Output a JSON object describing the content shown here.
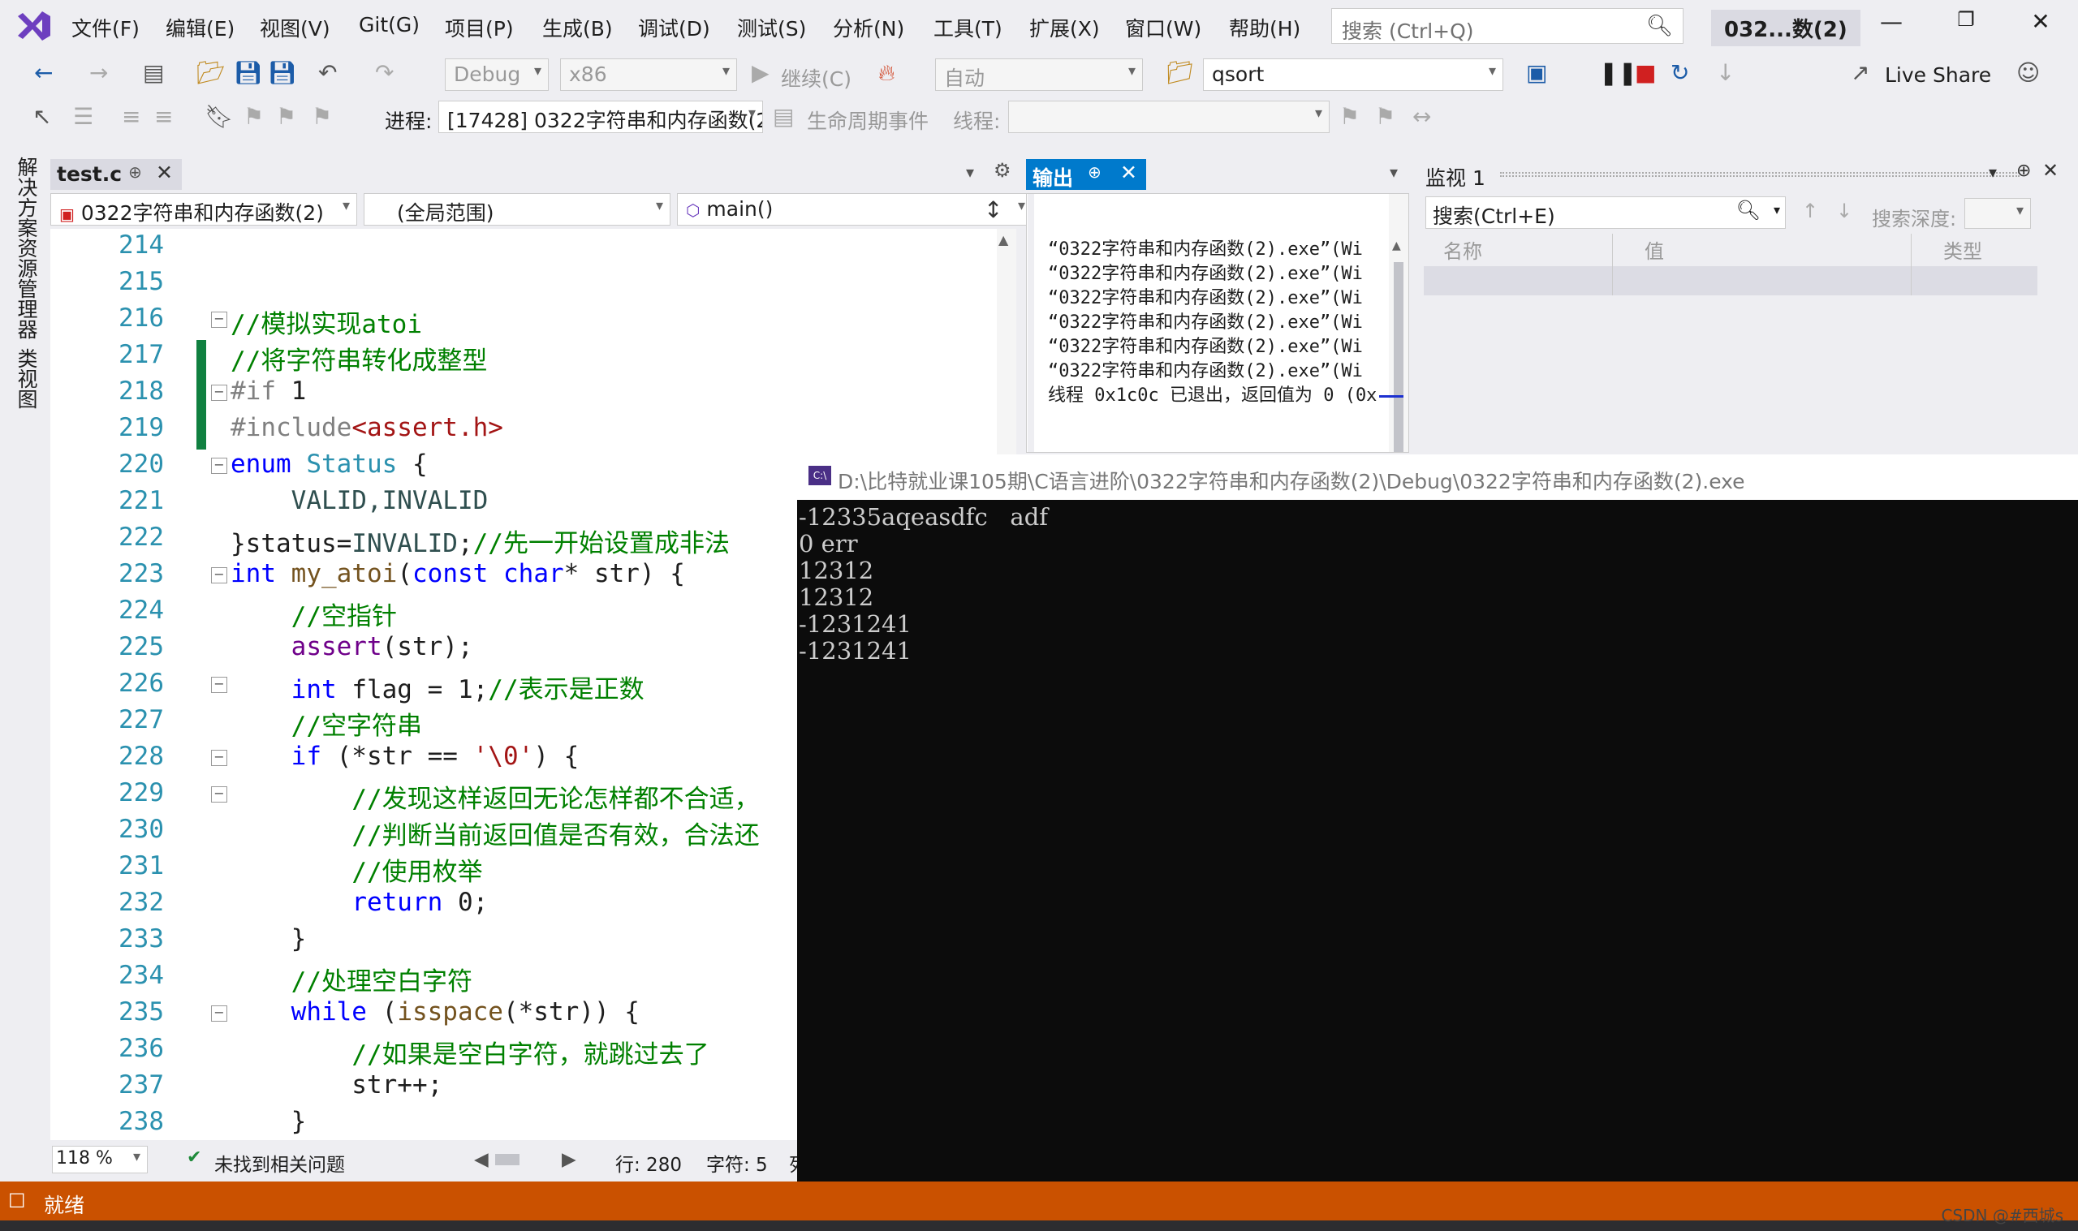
{
  "menu": [
    "文件(F)",
    "编辑(E)",
    "视图(V)",
    "Git(G)",
    "项目(P)",
    "生成(B)",
    "调试(D)",
    "测试(S)",
    "分析(N)",
    "工具(T)",
    "扩展(X)",
    "窗口(W)",
    "帮助(H)"
  ],
  "search": {
    "placeholder": "搜索 (Ctrl+Q)"
  },
  "window_title": "032...数(2)",
  "toolbar1": {
    "config": "Debug",
    "platform": "x86",
    "continue_label": "继续(C)",
    "auto": "自动",
    "find_combo": "qsort",
    "live_share": "Live Share"
  },
  "toolbar2": {
    "process_label": "进程:",
    "process_value": "[17428] 0322字符串和内存函数(2",
    "lifecycle": "生命周期事件",
    "thread_label": "线程:"
  },
  "side_tabs": [
    "解决方案资源管理器",
    "类视图"
  ],
  "editor": {
    "tab": "test.c",
    "nav_project": "0322字符串和内存函数(2)",
    "nav_scope": "(全局范围)",
    "nav_func": "main()",
    "line_numbers": [
      "214",
      "215",
      "216",
      "217",
      "218",
      "219",
      "220",
      "221",
      "222",
      "223",
      "224",
      "225",
      "226",
      "227",
      "228",
      "229",
      "230",
      "231",
      "232",
      "233",
      "234",
      "235",
      "236",
      "237",
      "238"
    ],
    "zoom": "118 %",
    "issues": "未找到相关问题",
    "line": "行: 280",
    "char": "字符: 5",
    "extra": "列"
  },
  "output": {
    "tab": "输出",
    "lines": [
      "“0322字符串和内存函数(2).exe”(Wi",
      "“0322字符串和内存函数(2).exe”(Wi",
      "“0322字符串和内存函数(2).exe”(Wi",
      "“0322字符串和内存函数(2).exe”(Wi",
      "“0322字符串和内存函数(2).exe”(Wi",
      "“0322字符串和内存函数(2).exe”(Wi",
      "线程 0x1c0c 已退出，返回值为 0 (0x"
    ]
  },
  "watch": {
    "title": "监视 1",
    "search_placeholder": "搜索(Ctrl+E)",
    "depth_label": "搜索深度:",
    "col_name": "名称",
    "col_value": "值",
    "col_type": "类型"
  },
  "console": {
    "title": "D:\\比特就业课105期\\C语言进阶\\0322字符串和内存函数(2)\\Debug\\0322字符串和内存函数(2).exe",
    "lines": [
      "-12335aqeasdfc   adf",
      "0 err",
      "12312",
      "12312",
      "-1231241",
      "-1231241"
    ]
  },
  "status": {
    "text": "就绪"
  },
  "watermark": "CSDN @#西城s",
  "colors": {
    "accent": "#007acc",
    "status_bar": "#ca5100",
    "console_bg": "#0c0c0c"
  }
}
